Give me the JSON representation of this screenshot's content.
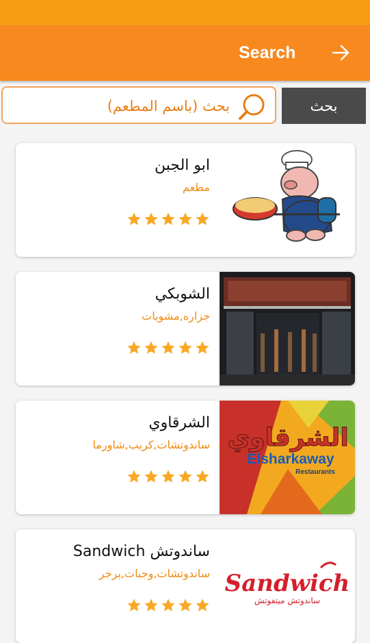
{
  "header": {
    "title": "Search",
    "back_icon": "arrow-right-icon"
  },
  "search": {
    "placeholder": "بحث (باسم المطعم)",
    "value": "",
    "button_label": "بحث",
    "icon": "search-icon"
  },
  "colors": {
    "accent": "#f7891f",
    "status_bar": "#f89c14",
    "star": "#f9a825",
    "button": "#4a4a4a"
  },
  "restaurants": [
    {
      "name": "ابو الجبن",
      "category": "مطعم",
      "rating": 5,
      "image": "chef-cartoon"
    },
    {
      "name": "الشوبكي",
      "category": "جزاره,مشويات",
      "rating": 5,
      "image": "shop-front-photo"
    },
    {
      "name": "الشرقاوي",
      "category": "ساندوتشات,كريب,شاورما",
      "rating": 5,
      "image": "elsharkaway-logo",
      "logo_text": {
        "arabic": "الشرقاوي",
        "latin": "Elsharkaway",
        "sub": "Restaurants"
      }
    },
    {
      "name": "ساندوتش Sandwich",
      "category": "ساندوتشات,وجبات,برجر",
      "rating": 5,
      "image": "sandwich-logo",
      "logo_text": {
        "latin": "Sandwich",
        "arabic": "ساندوتش ميتفوتش"
      }
    }
  ]
}
